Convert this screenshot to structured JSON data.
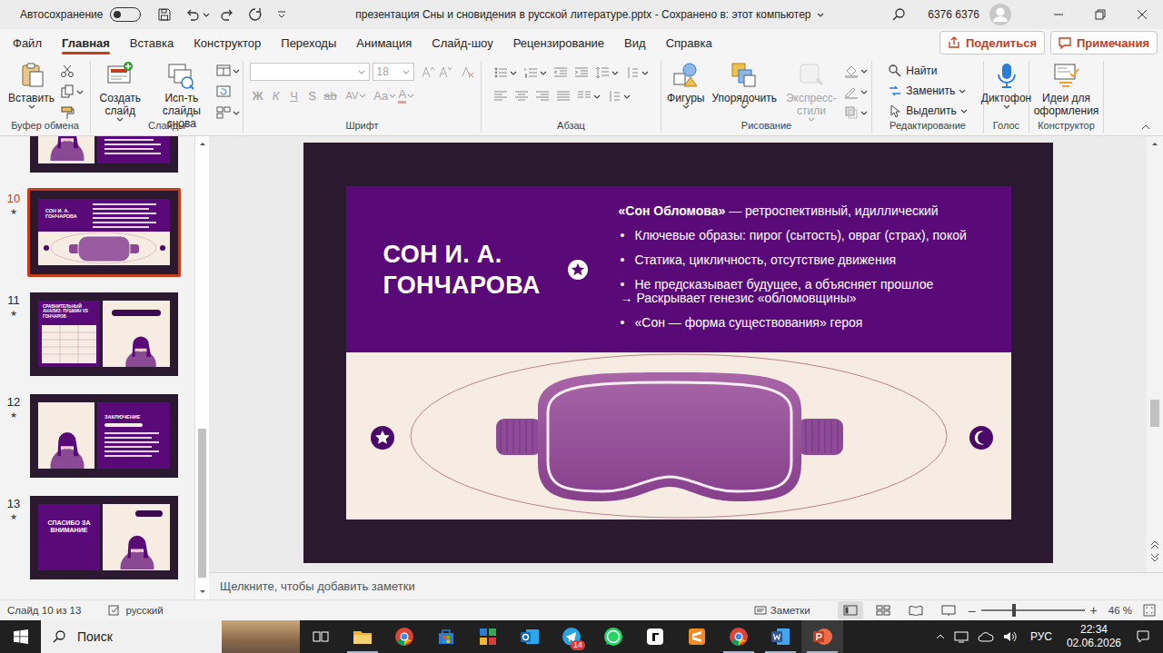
{
  "window": {
    "autosave_label": "Автосохранение",
    "autosave_on": false,
    "title": "презентация Сны и сновидения в русской литературе.pptx  -  Сохранено в: этот компьютер",
    "user": "6376 6376"
  },
  "tabs": [
    {
      "label": "Файл",
      "selected": false
    },
    {
      "label": "Главная",
      "selected": true
    },
    {
      "label": "Вставка",
      "selected": false
    },
    {
      "label": "Конструктор",
      "selected": false
    },
    {
      "label": "Переходы",
      "selected": false
    },
    {
      "label": "Анимация",
      "selected": false
    },
    {
      "label": "Слайд-шоу",
      "selected": false
    },
    {
      "label": "Рецензирование",
      "selected": false
    },
    {
      "label": "Вид",
      "selected": false
    },
    {
      "label": "Справка",
      "selected": false
    }
  ],
  "share_button": "Поделиться",
  "comments_button": "Примечания",
  "ribbon": {
    "groups": [
      {
        "kind": "clipboard",
        "label": "Буфер обмена",
        "buttons": [
          "Вставить"
        ]
      },
      {
        "kind": "slides",
        "label": "Слайды",
        "buttons": [
          "Создать слайд",
          "Исп-ть слайды снова"
        ]
      },
      {
        "kind": "font",
        "label": "Шрифт",
        "disabled": true,
        "font_name": "",
        "font_size": "18",
        "buttons": [
          "Ж",
          "К",
          "Ч",
          "S",
          "ab",
          "AV",
          "Aa",
          "A"
        ]
      },
      {
        "kind": "paragraph",
        "label": "Абзац"
      },
      {
        "kind": "drawing",
        "label": "Рисование",
        "buttons": [
          {
            "label": "Фигуры",
            "disabled": false
          },
          {
            "label": "Упорядочить",
            "disabled": false
          },
          {
            "label": "Экспресс-стили",
            "disabled": true
          }
        ]
      },
      {
        "kind": "editing",
        "label": "Редактирование",
        "buttons": [
          "Найти",
          "Заменить",
          "Выделить"
        ]
      },
      {
        "kind": "voice",
        "label": "Голос",
        "buttons": [
          "Диктофон"
        ]
      },
      {
        "kind": "designer",
        "label": "Конструктор",
        "buttons": [
          "Идеи для оформления"
        ]
      }
    ]
  },
  "thumbnails": [
    {
      "kind": "partial",
      "selected": false
    },
    {
      "number": "10",
      "star": "★",
      "kind": "title-mask",
      "selected": true,
      "title": "СОН И. А. ГОНЧАРОВА"
    },
    {
      "number": "11",
      "star": "★",
      "kind": "compare",
      "selected": false,
      "title": "СРАВНИТЕЛЬНЫЙ АНАЛИЗ: ПУШКИН VS ГОНЧАРОВ"
    },
    {
      "number": "12",
      "star": "★",
      "kind": "conclusion",
      "selected": false,
      "title": "ЗАКЛЮЧЕНИЕ"
    },
    {
      "number": "13",
      "star": "★",
      "kind": "thanks",
      "selected": false,
      "title": "СПАСИБО ЗА ВНИМАНИЕ"
    }
  ],
  "slide": {
    "title": "СОН И. А. ГОНЧАРОВА",
    "lead_bold": "«Сон Обломова»",
    "lead_rest": " — ретроспективный, идиллический",
    "bullet_char": "•",
    "bullets": [
      {
        "text": "Ключевые образы: пирог (сытость), овраг (страх), покой"
      },
      {
        "text": "Статика, цикличность, отсутствие движения"
      },
      {
        "text": "Не предсказывает будущее, а объясняет прошлое",
        "sub": "→ Раскрывает генезис «обломовщины»"
      },
      {
        "text": "«Сон — форма существования» героя"
      }
    ]
  },
  "notes_placeholder": "Щелкните, чтобы добавить заметки",
  "status_bar": {
    "slide_info": "Слайд 10 из 13",
    "language": "русский",
    "notes_button": "Заметки",
    "zoom_minus": "–",
    "zoom_plus": "+",
    "zoom": "46 %",
    "zoom_level": 0.32
  },
  "taskbar": {
    "search_placeholder": "Поиск",
    "apps": [
      {
        "kind": "folder",
        "color": "#f2b632",
        "running": true,
        "active": false
      },
      {
        "kind": "chrome",
        "color": "#db4437",
        "running": false,
        "active": false
      },
      {
        "kind": "store",
        "color": "#2b7cd3",
        "running": false,
        "active": false
      },
      {
        "kind": "tiles",
        "color": "#3aa655",
        "running": false,
        "active": false
      },
      {
        "kind": "mail",
        "color": "#0f6cbd",
        "running": false,
        "active": false
      },
      {
        "kind": "telegram",
        "color": "#2aa3df",
        "running": false,
        "active": false,
        "badge": "14"
      },
      {
        "kind": "whatsapp",
        "color": "#25d366",
        "running": false,
        "active": false
      },
      {
        "kind": "note",
        "color": "#111111",
        "running": false,
        "active": false
      },
      {
        "kind": "sublime",
        "color": "#f08a24",
        "running": false,
        "active": false
      },
      {
        "kind": "chrome",
        "color": "#db4437",
        "running": true,
        "active": false
      },
      {
        "kind": "word",
        "color": "#2b579a",
        "running": true,
        "active": false
      },
      {
        "kind": "powerpoint",
        "color": "#c43e1c",
        "running": true,
        "active": true
      }
    ],
    "language": "РУС",
    "time": "22:34",
    "date": "02.06.2026"
  }
}
